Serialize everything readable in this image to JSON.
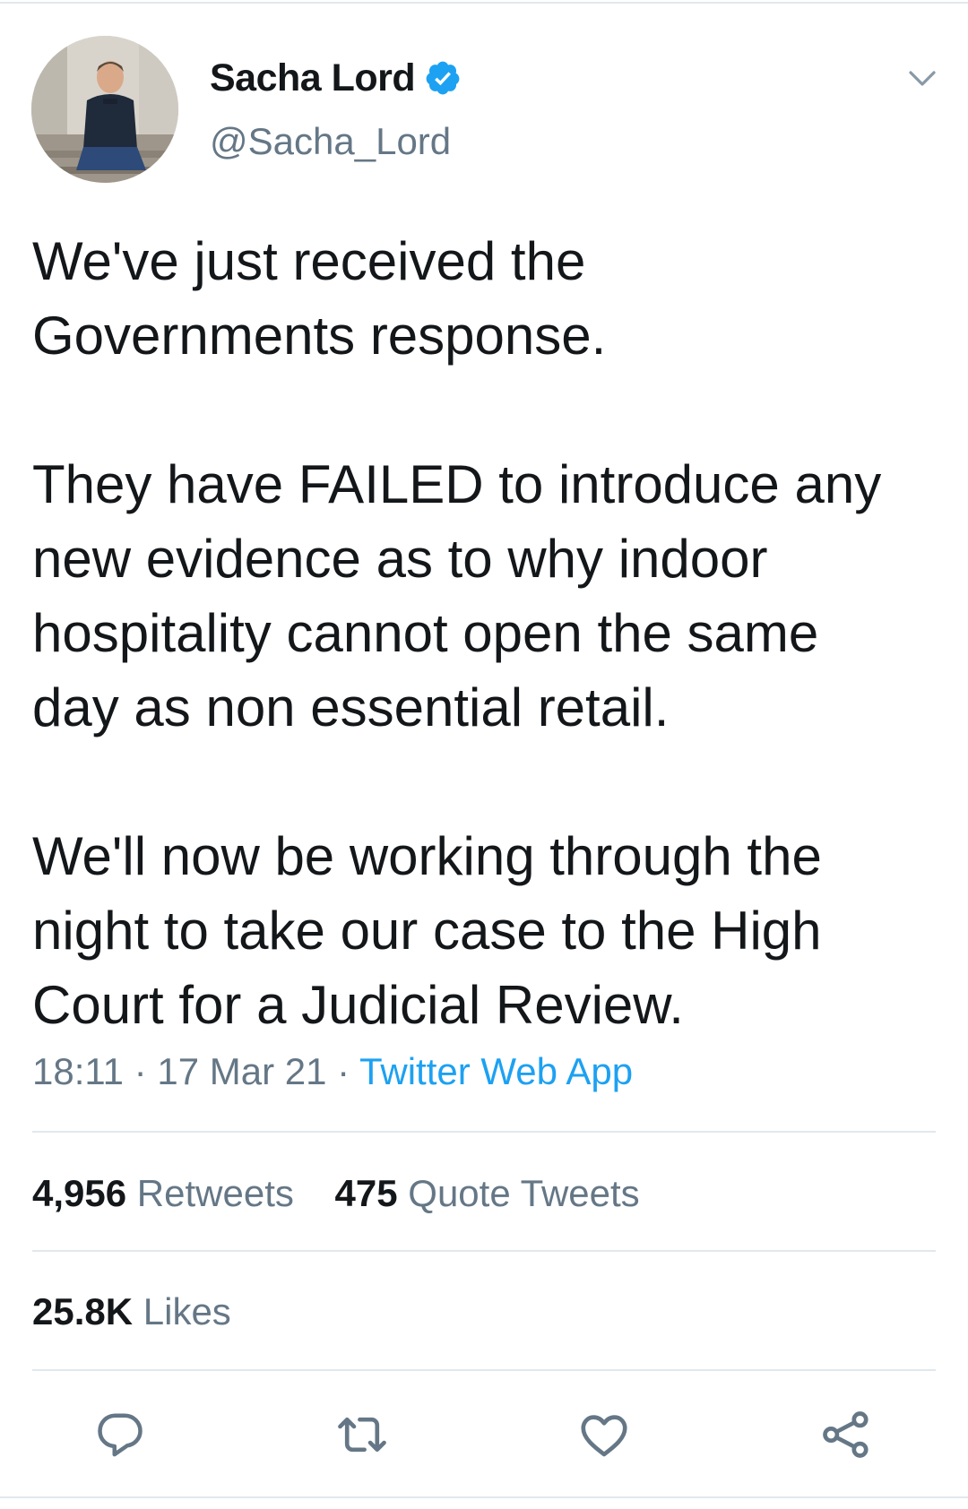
{
  "user": {
    "display_name": "Sacha Lord",
    "handle": "@Sacha_Lord",
    "verified": true,
    "verified_color": "#1da1f2"
  },
  "tweet": {
    "paragraphs": [
      "We've just received the\nGovernments response.",
      "They have FAILED to introduce any\nnew evidence as to why indoor\nhospitality cannot open the same\nday as non essential retail.",
      "We'll now be working through the\nnight to take our case to the High\nCourt for a Judicial Review."
    ],
    "time": "18:11",
    "separator": "·",
    "date": "17 Mar 21",
    "source": "Twitter Web App"
  },
  "stats": {
    "retweets_count": "4,956",
    "retweets_label": "Retweets",
    "quotes_count": "475",
    "quotes_label": "Quote Tweets",
    "likes_count": "25.8K",
    "likes_label": "Likes"
  },
  "actions": {
    "reply_icon": "reply-icon",
    "retweet_icon": "retweet-icon",
    "like_icon": "heart-icon",
    "share_icon": "share-icon",
    "icon_color": "#657786"
  },
  "menu": {
    "icon": "chevron-down-icon"
  }
}
